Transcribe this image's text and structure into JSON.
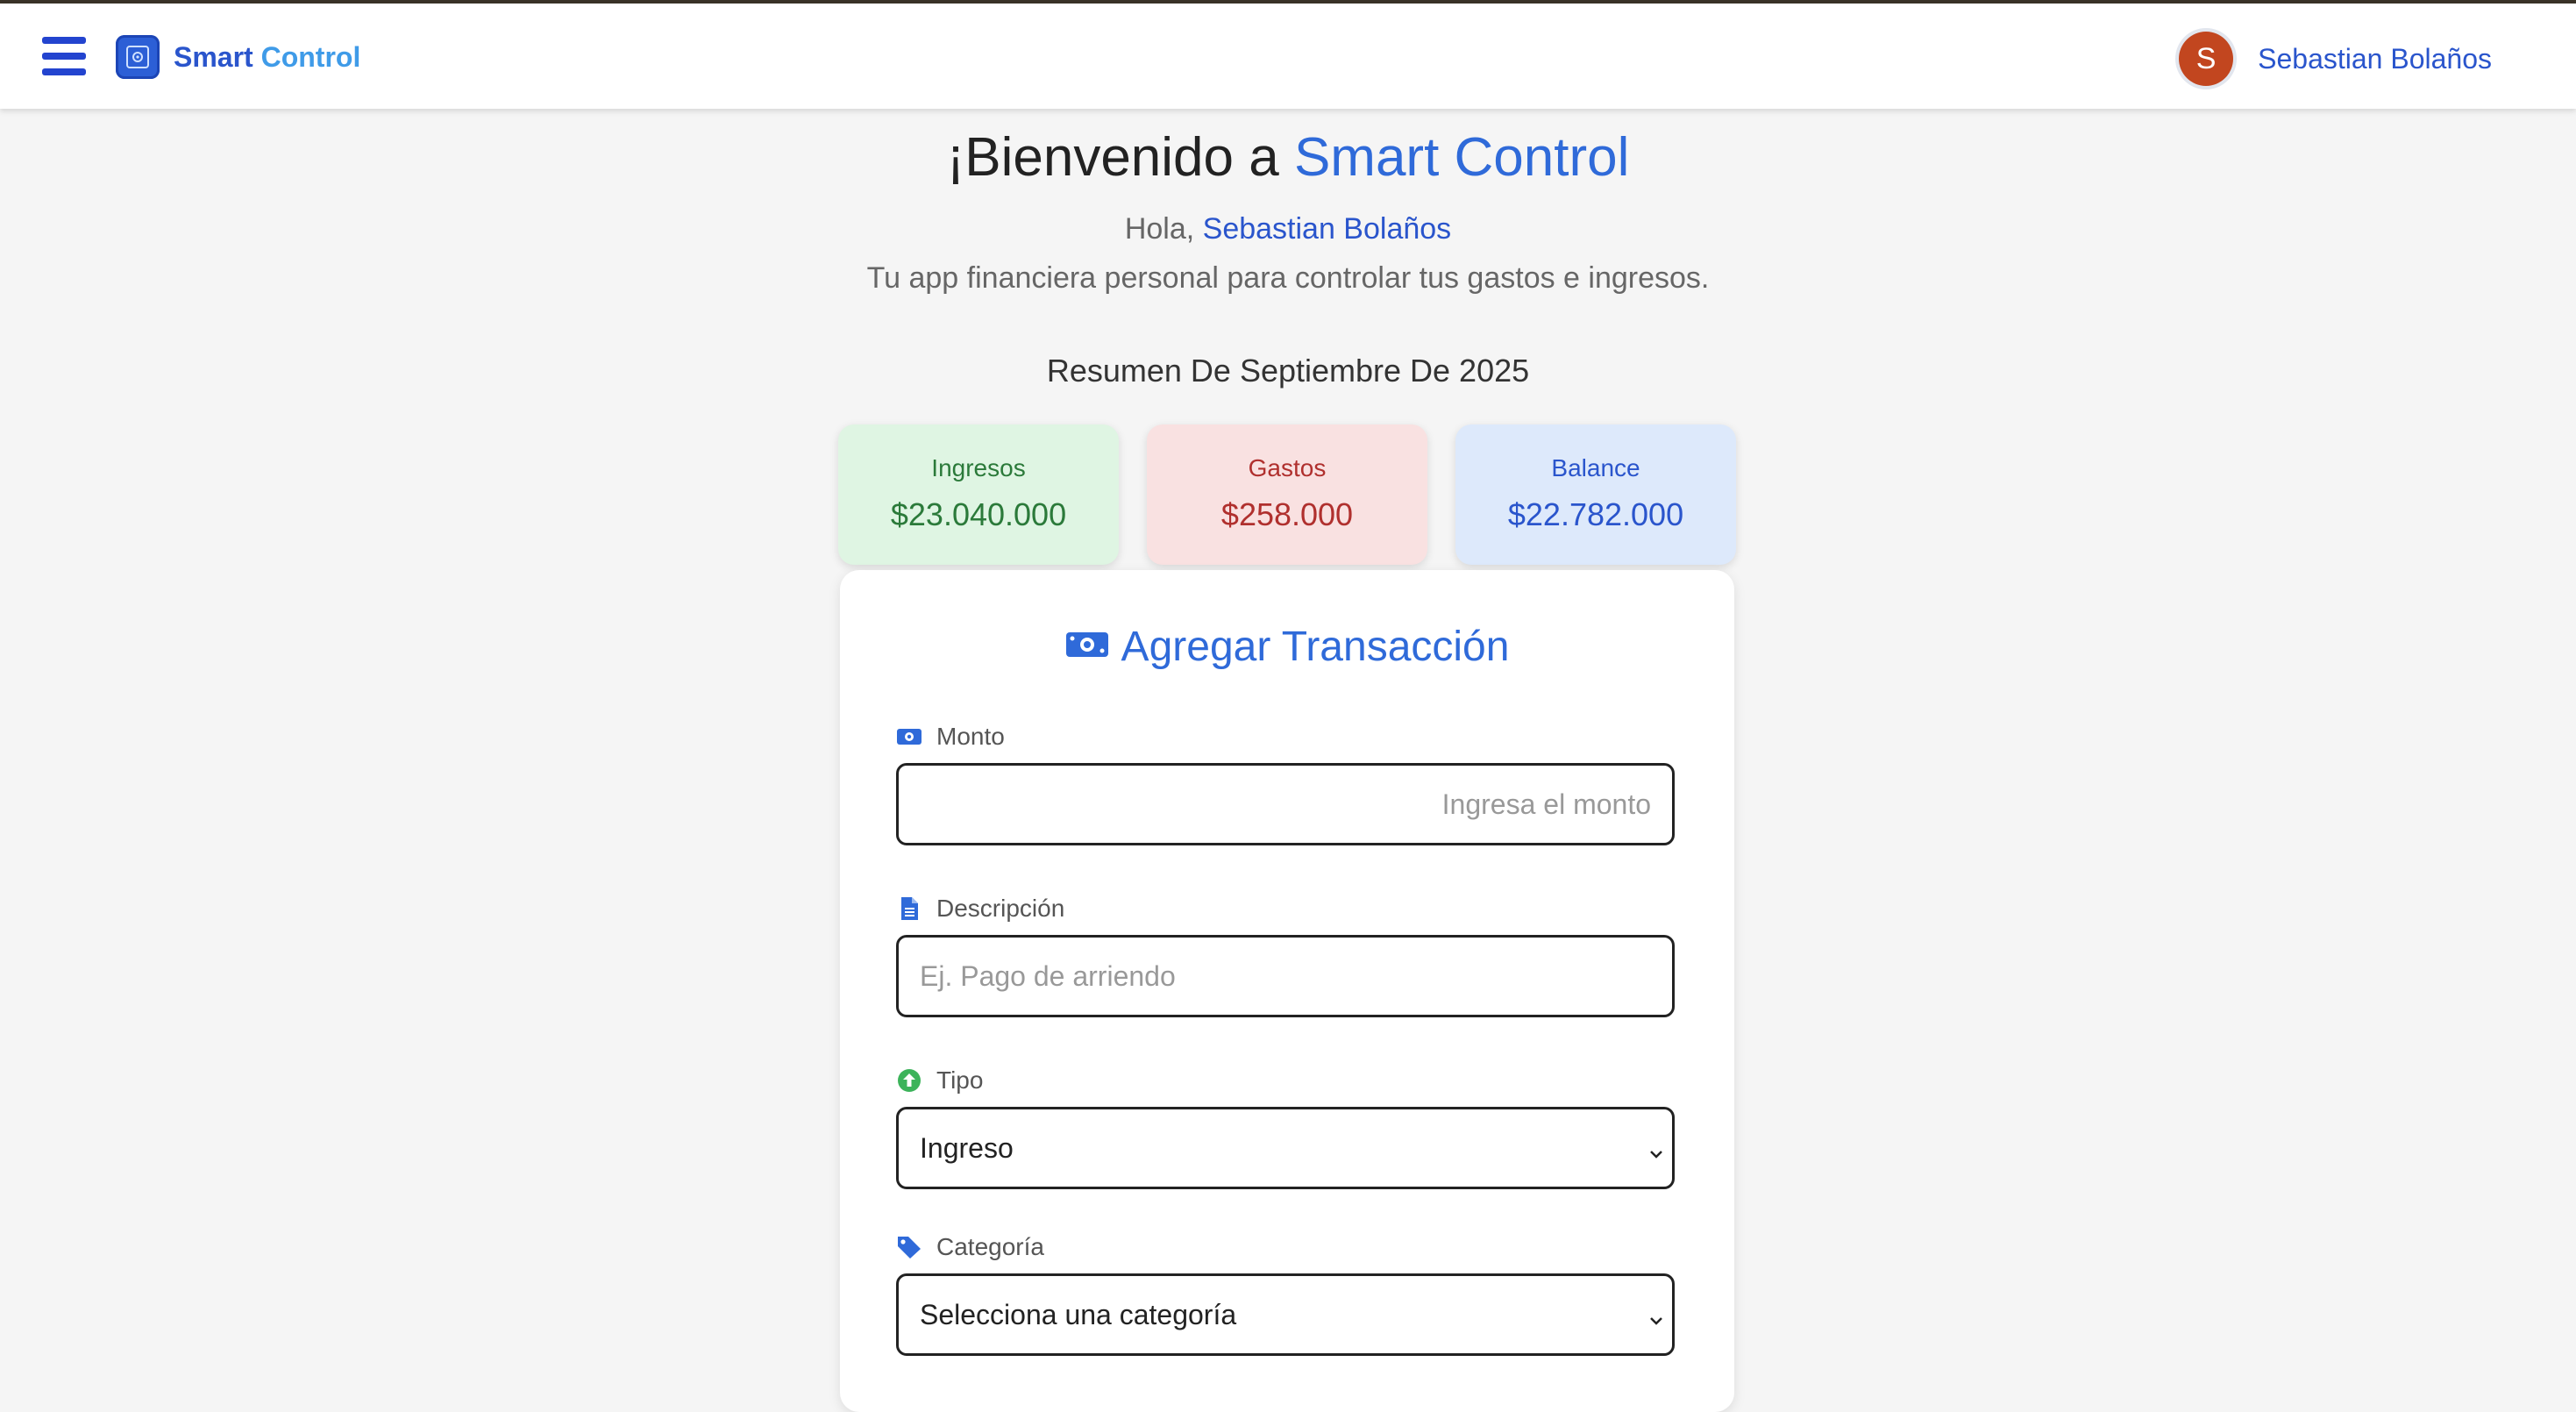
{
  "navbar": {
    "brand_primary": "Smart",
    "brand_secondary": "Control",
    "user_initial": "S",
    "user_name": "Sebastian Bolaños"
  },
  "hero": {
    "title_prefix": "¡Bienvenido a ",
    "title_accent": "Smart Control",
    "hello_prefix": "Hola, ",
    "hello_name": "Sebastian Bolaños",
    "tagline": "Tu app financiera personal para controlar tus gastos e ingresos."
  },
  "summary": {
    "title": "Resumen De Septiembre De 2025",
    "income_label": "Ingresos",
    "income_value": "$23.040.000",
    "expense_label": "Gastos",
    "expense_value": "$258.000",
    "balance_label": "Balance",
    "balance_value": "$22.782.000"
  },
  "form": {
    "title": "Agregar Transacción",
    "amount_label": "Monto",
    "amount_placeholder": "Ingresa el monto",
    "description_label": "Descripción",
    "description_placeholder": "Ej. Pago de arriendo",
    "type_label": "Tipo",
    "type_value": "Ingreso",
    "category_label": "Categoría",
    "category_value": "Selecciona una categoría"
  },
  "icons": {
    "menu": "hamburger-icon",
    "logo": "safe-logo-icon",
    "money": "money-bill-icon",
    "description": "file-text-icon",
    "type": "arrow-up-circle-icon",
    "category": "tag-icon",
    "dropdown": "chevron-down-icon"
  },
  "colors": {
    "accent": "#2f6ad9",
    "brand_dark": "#2a55cc",
    "brand_light": "#3f9be8",
    "income_bg": "#dff5e3",
    "income_text": "#2b7a3a",
    "expense_bg": "#f9e1e1",
    "expense_text": "#b0302e",
    "balance_bg": "#dde9fb",
    "avatar_bg": "#c2461f",
    "type_icon": "#3cb35a"
  }
}
